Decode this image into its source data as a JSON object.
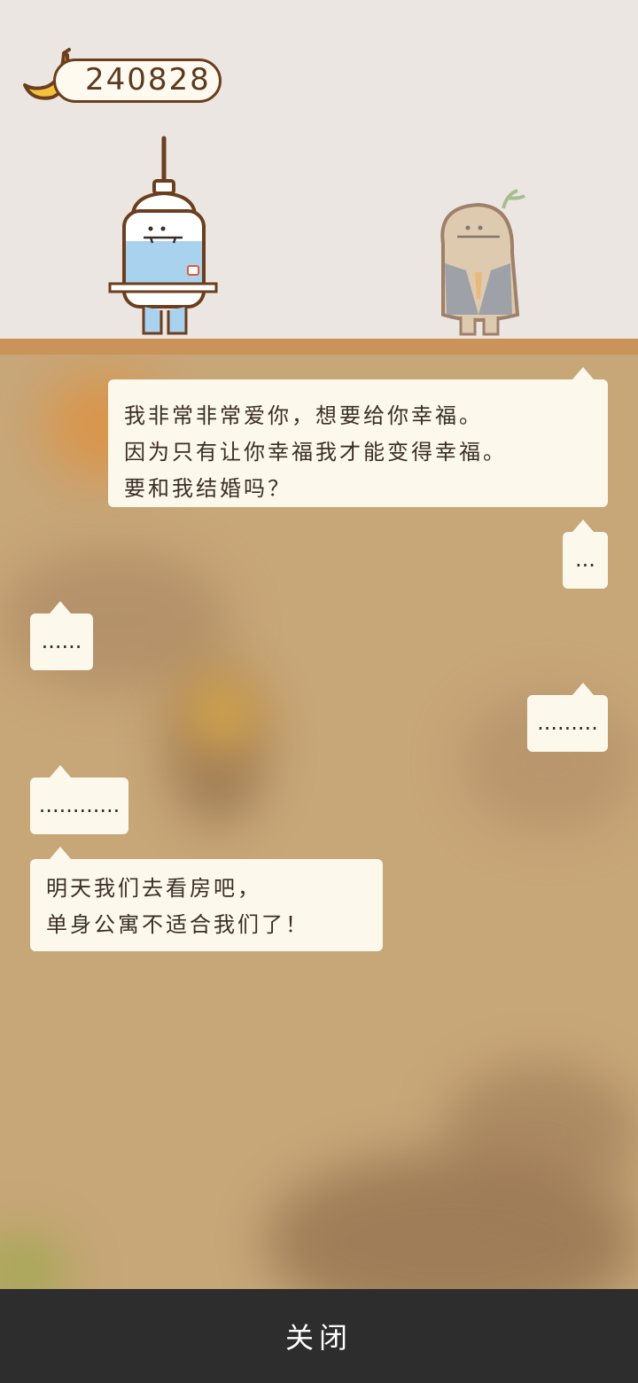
{
  "header": {
    "coin_count": "240828",
    "coin_icon": "banana-icon"
  },
  "characters": {
    "left": "syringe-character",
    "right": "potato-in-suit-character"
  },
  "dialogue": [
    {
      "side": "right",
      "lines": [
        "我非常非常爱你，想要给你幸福。",
        "因为只有让你幸福我才能变得幸福。",
        "要和我结婚吗？"
      ]
    },
    {
      "side": "right",
      "lines": [
        "..."
      ]
    },
    {
      "side": "left",
      "lines": [
        "......"
      ]
    },
    {
      "side": "right",
      "lines": [
        "........."
      ]
    },
    {
      "side": "left",
      "lines": [
        "............"
      ]
    },
    {
      "side": "left",
      "lines": [
        "明天我们去看房吧，",
        "单身公寓不适合我们了！"
      ]
    }
  ],
  "footer": {
    "close_label": "关闭"
  },
  "colors": {
    "scene_bg": "#ebe6e1",
    "shelf": "#c9935a",
    "overlay": "#c7a678",
    "bubble_bg": "#fdf8ec",
    "bottom_bar": "#2d2d2d"
  }
}
